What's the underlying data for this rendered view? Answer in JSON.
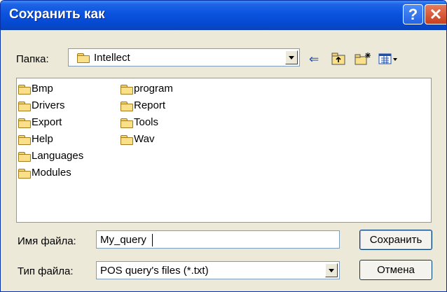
{
  "window": {
    "title": "Сохранить как"
  },
  "folder_bar": {
    "label": "Папка:",
    "current": "Intellect"
  },
  "toolbar": {
    "back_icon": "arrow-left-icon",
    "up_icon": "folder-up-icon",
    "new_folder_icon": "new-folder-icon",
    "view_icon": "view-menu-icon"
  },
  "files": {
    "col1": [
      "Bmp",
      "Drivers",
      "Export",
      "Help",
      "Languages",
      "Modules"
    ],
    "col2": [
      "program",
      "Report",
      "Tools",
      "Wav"
    ]
  },
  "filename": {
    "label": "Имя файла:",
    "value": "My_query"
  },
  "filetype": {
    "label": "Тип файла:",
    "value": "POS query's files (*.txt)"
  },
  "buttons": {
    "save": "Сохранить",
    "cancel": "Отмена"
  },
  "colors": {
    "titlebar": "#0a53de",
    "dialog": "#ece9d8",
    "accent": "#003c74"
  }
}
